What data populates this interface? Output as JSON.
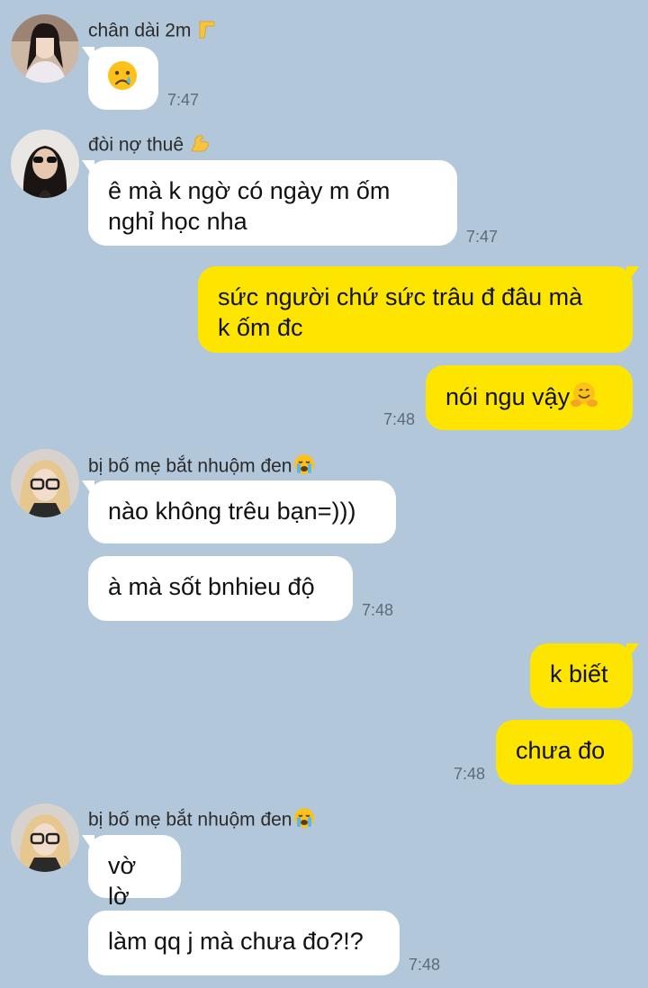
{
  "groups": [
    {
      "sender": "chân dài 2m",
      "sender_emoji_icon": "leg-icon",
      "messages": [
        {
          "text": "",
          "emoji_icon": "crying-face-icon",
          "time": "7:47"
        }
      ]
    },
    {
      "sender": "đòi nợ thuê",
      "sender_emoji_icon": "flexed-biceps-icon",
      "messages": [
        {
          "text_line1": "ê mà k ngờ có ngày m ốm",
          "text_line2": "nghỉ học nha",
          "time": "7:47"
        }
      ]
    },
    {
      "outgoing": true,
      "messages": [
        {
          "text_line1": "sức người chứ sức trâu đ đâu mà",
          "text_line2": "k ốm đc"
        },
        {
          "text": "nói ngu vậy",
          "emoji_icon": "hugging-face-icon",
          "time": "7:48"
        }
      ]
    },
    {
      "sender": "bị bố mẹ bắt nhuộm đen",
      "sender_emoji_icon": "loudly-crying-face-icon",
      "messages": [
        {
          "text": "nào không trêu bạn=)))"
        },
        {
          "text": "à mà sốt bnhieu độ",
          "time": "7:48"
        }
      ]
    },
    {
      "outgoing": true,
      "messages": [
        {
          "text": "k biết"
        },
        {
          "text": "chưa đo",
          "time": "7:48"
        }
      ]
    },
    {
      "sender": "bị bố mẹ bắt nhuộm đen",
      "sender_emoji_icon": "loudly-crying-face-icon",
      "messages": [
        {
          "text": "vờ lờ"
        },
        {
          "text": "làm qq j mà chưa đo?!?",
          "time": "7:48"
        }
      ]
    }
  ],
  "colors": {
    "background": "#b2c7da",
    "incoming_bubble": "#ffffff",
    "outgoing_bubble": "#fee500",
    "timestamp": "#5e6b77"
  }
}
